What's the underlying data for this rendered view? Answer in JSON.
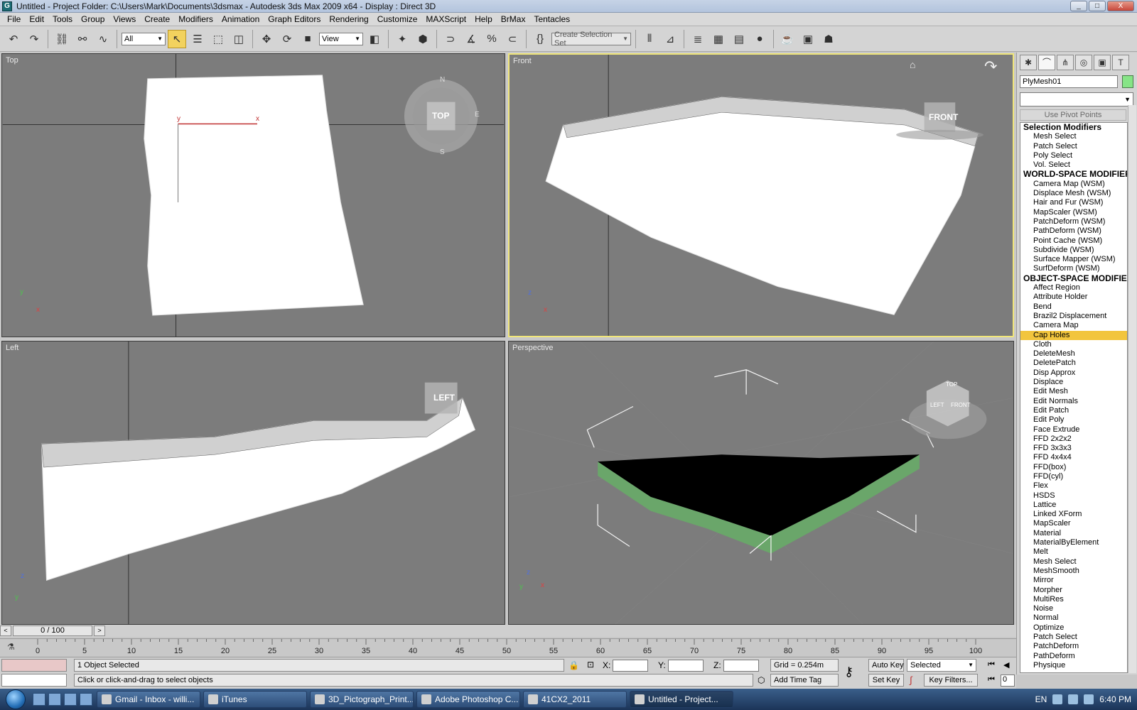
{
  "titlebar": {
    "title": "Untitled    - Project Folder: C:\\Users\\Mark\\Documents\\3dsmax    - Autodesk 3ds Max  2009 x64     - Display : Direct 3D",
    "minimize": "_",
    "maximize": "□",
    "close": "X"
  },
  "menubar": {
    "items": [
      "File",
      "Edit",
      "Tools",
      "Group",
      "Views",
      "Create",
      "Modifiers",
      "Animation",
      "Graph Editors",
      "Rendering",
      "Customize",
      "MAXScript",
      "Help",
      "BrMax",
      "Tentacles"
    ]
  },
  "toolbar": {
    "selection_filter": "All",
    "ref_coord": "View",
    "named_selection_placeholder": "Create Selection Set"
  },
  "viewports": {
    "top": {
      "label": "Top",
      "cube": "TOP",
      "compass_n": "N",
      "compass_s": "S",
      "compass_e": "E",
      "axis_x": "x",
      "axis_y": "y"
    },
    "front": {
      "label": "Front",
      "cube": "FRONT",
      "axis_x": "x",
      "axis_z": "z"
    },
    "left": {
      "label": "Left",
      "cube": "LEFT",
      "axis_y": "y",
      "axis_z": "z"
    },
    "perspective": {
      "label": "Perspective",
      "cube_top": "TOP",
      "cube_left": "LEFT",
      "cube_front": "FRONT",
      "axis_x": "x",
      "axis_y": "y",
      "axis_z": "z"
    }
  },
  "command_panel": {
    "object_name": "PlyMesh01",
    "object_color": "#86e486",
    "use_pivot": "Use Pivot Points",
    "modifier_list": [
      {
        "type": "header",
        "label": "Selection Modifiers"
      },
      {
        "type": "item",
        "label": "Mesh Select"
      },
      {
        "type": "item",
        "label": "Patch Select"
      },
      {
        "type": "item",
        "label": "Poly Select"
      },
      {
        "type": "item",
        "label": "Vol. Select"
      },
      {
        "type": "header",
        "label": "WORLD-SPACE MODIFIERS"
      },
      {
        "type": "item",
        "label": "Camera Map (WSM)"
      },
      {
        "type": "item",
        "label": "Displace Mesh (WSM)"
      },
      {
        "type": "item",
        "label": "Hair and Fur (WSM)"
      },
      {
        "type": "item",
        "label": "MapScaler (WSM)"
      },
      {
        "type": "item",
        "label": "PatchDeform (WSM)"
      },
      {
        "type": "item",
        "label": "PathDeform (WSM)"
      },
      {
        "type": "item",
        "label": "Point Cache (WSM)"
      },
      {
        "type": "item",
        "label": "Subdivide (WSM)"
      },
      {
        "type": "item",
        "label": "Surface Mapper (WSM)"
      },
      {
        "type": "item",
        "label": "SurfDeform (WSM)"
      },
      {
        "type": "header",
        "label": "OBJECT-SPACE MODIFIERS"
      },
      {
        "type": "item",
        "label": "Affect Region"
      },
      {
        "type": "item",
        "label": "Attribute Holder"
      },
      {
        "type": "item",
        "label": "Bend"
      },
      {
        "type": "item",
        "label": "Brazil2 Displacement"
      },
      {
        "type": "item",
        "label": "Camera Map"
      },
      {
        "type": "item",
        "label": "Cap Holes",
        "selected": true
      },
      {
        "type": "item",
        "label": "Cloth"
      },
      {
        "type": "item",
        "label": "DeleteMesh"
      },
      {
        "type": "item",
        "label": "DeletePatch"
      },
      {
        "type": "item",
        "label": "Disp Approx"
      },
      {
        "type": "item",
        "label": "Displace"
      },
      {
        "type": "item",
        "label": "Edit Mesh"
      },
      {
        "type": "item",
        "label": "Edit Normals"
      },
      {
        "type": "item",
        "label": "Edit Patch"
      },
      {
        "type": "item",
        "label": "Edit Poly"
      },
      {
        "type": "item",
        "label": "Face Extrude"
      },
      {
        "type": "item",
        "label": "FFD 2x2x2"
      },
      {
        "type": "item",
        "label": "FFD 3x3x3"
      },
      {
        "type": "item",
        "label": "FFD 4x4x4"
      },
      {
        "type": "item",
        "label": "FFD(box)"
      },
      {
        "type": "item",
        "label": "FFD(cyl)"
      },
      {
        "type": "item",
        "label": "Flex"
      },
      {
        "type": "item",
        "label": "HSDS"
      },
      {
        "type": "item",
        "label": "Lattice"
      },
      {
        "type": "item",
        "label": "Linked XForm"
      },
      {
        "type": "item",
        "label": "MapScaler"
      },
      {
        "type": "item",
        "label": "Material"
      },
      {
        "type": "item",
        "label": "MaterialByElement"
      },
      {
        "type": "item",
        "label": "Melt"
      },
      {
        "type": "item",
        "label": "Mesh Select"
      },
      {
        "type": "item",
        "label": "MeshSmooth"
      },
      {
        "type": "item",
        "label": "Mirror"
      },
      {
        "type": "item",
        "label": "Morpher"
      },
      {
        "type": "item",
        "label": "MultiRes"
      },
      {
        "type": "item",
        "label": "Noise"
      },
      {
        "type": "item",
        "label": "Normal"
      },
      {
        "type": "item",
        "label": "Optimize"
      },
      {
        "type": "item",
        "label": "Patch Select"
      },
      {
        "type": "item",
        "label": "PatchDeform"
      },
      {
        "type": "item",
        "label": "PathDeform"
      },
      {
        "type": "item",
        "label": "Physique"
      }
    ]
  },
  "timeline": {
    "slider": "0 / 100",
    "arrow_left": "<",
    "arrow_right": ">",
    "ticks": [
      0,
      5,
      10,
      15,
      20,
      25,
      30,
      35,
      40,
      45,
      50,
      55,
      60,
      65,
      70,
      75,
      80,
      85,
      90,
      95,
      100
    ]
  },
  "status": {
    "selected_count": "1 Object Selected",
    "prompt": "Click or click-and-drag to select objects",
    "x_label": "X:",
    "y_label": "Y:",
    "z_label": "Z:",
    "grid": "Grid = 0.254m",
    "add_time_tag": "Add Time Tag",
    "auto_key": "Auto Key",
    "set_key": "Set Key",
    "key_mode": "Selected",
    "key_filters": "Key Filters...",
    "frame": "0"
  },
  "taskbar": {
    "items": [
      "Gmail - Inbox - willi...",
      "iTunes",
      "3D_Pictograph_Print...",
      "Adobe Photoshop C...",
      "41CX2_2011",
      "Untitled    - Project..."
    ],
    "lang": "EN",
    "time": "6:40 PM"
  }
}
